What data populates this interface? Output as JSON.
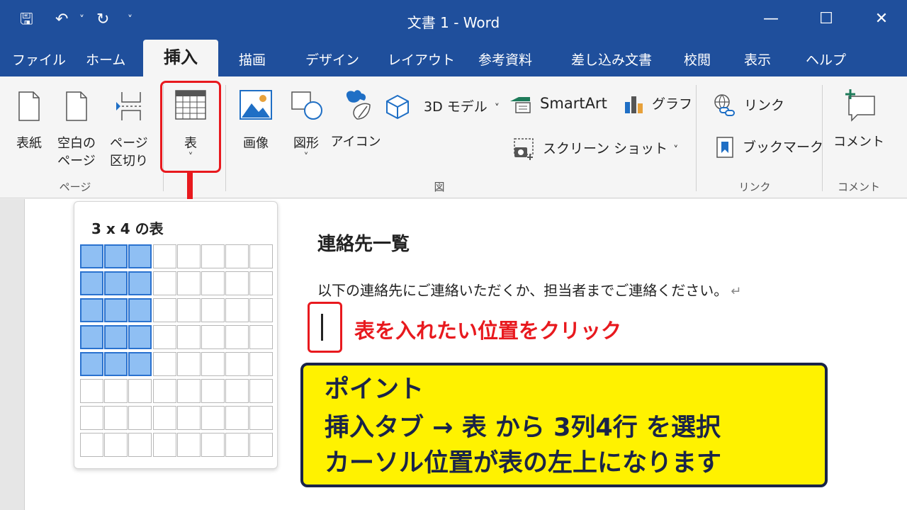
{
  "window": {
    "title": "文書 1  -  Word",
    "quick_access": {
      "save": "🖫",
      "undo": "↶",
      "undo_caret": "˅",
      "redo": "↻",
      "more": "˅"
    },
    "controls": {
      "minimize": "—",
      "maximize": "☐",
      "close": "✕"
    }
  },
  "tabs": [
    {
      "label": "ファイル"
    },
    {
      "label": "ホーム"
    },
    {
      "label": "挿入",
      "active": true
    },
    {
      "label": "描画"
    },
    {
      "label": "デザイン"
    },
    {
      "label": "レイアウト"
    },
    {
      "label": "参考資料"
    },
    {
      "label": "差し込み文書"
    },
    {
      "label": "校閲"
    },
    {
      "label": "表示"
    },
    {
      "label": "ヘルプ"
    }
  ],
  "ribbon": {
    "groups": {
      "page": "ページ",
      "illustrations": "図",
      "links": "リンク",
      "comments": "コメント"
    },
    "buttons": {
      "cover": "表紙",
      "blank_page_1": "空白の",
      "blank_page_2": "ページ",
      "page_break_1": "ページ",
      "page_break_2": "区切り",
      "table": "表",
      "table_caret": "˅",
      "image": "画像",
      "shapes": "図形",
      "shapes_caret": "˅",
      "icons": "アイコン",
      "model3d": "3D モデル",
      "model3d_caret": "˅",
      "smartart": "SmartArt",
      "chart": "グラフ",
      "screenshot": "スクリーン ショット",
      "screenshot_caret": "˅",
      "link": "リンク",
      "bookmark": "ブックマーク",
      "comment": "コメント"
    }
  },
  "table_grid": {
    "title": "3 x 4 の表",
    "columns": 8,
    "rows": 8,
    "selected_columns": 3,
    "selected_rows": 5
  },
  "document": {
    "heading": "連絡先一覧",
    "body": "以下の連絡先にご連絡いただくか、担当者までご連絡ください。",
    "paragraph_mark": "↵",
    "click_note": "表を入れたい位置をクリック"
  },
  "point": {
    "title": "ポイント",
    "line1": "挿入タブ → 表 から 3列4行 を選択",
    "line2": "カーソル位置が表の左上になります"
  },
  "colors": {
    "title_bar": "#1f4f9c",
    "highlight_red": "#e8191e",
    "selected_cell": "#8fbff3",
    "point_bg": "#fff200",
    "point_text": "#1a2448"
  }
}
